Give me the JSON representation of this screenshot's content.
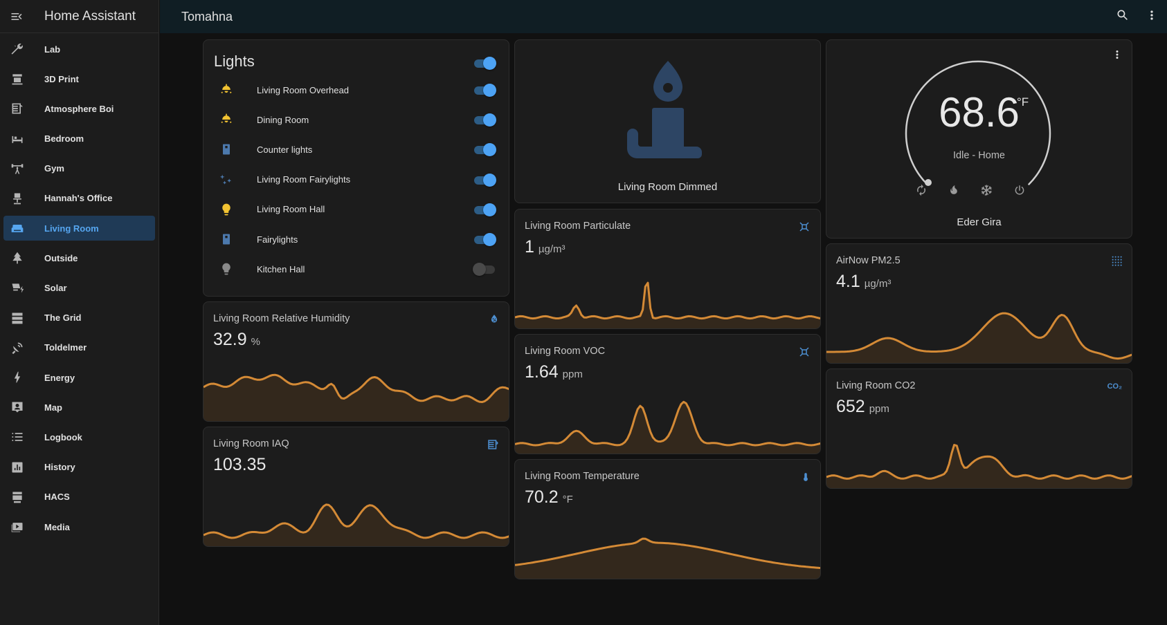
{
  "app": {
    "title": "Home Assistant"
  },
  "view": {
    "title": "Tomahna"
  },
  "sidebar": {
    "items": [
      {
        "label": "Lab",
        "icon": "tools-icon"
      },
      {
        "label": "3D Print",
        "icon": "printer-3d-icon"
      },
      {
        "label": "Atmosphere Boi",
        "icon": "air-filter-icon"
      },
      {
        "label": "Bedroom",
        "icon": "bed-icon"
      },
      {
        "label": "Gym",
        "icon": "weight-lifter-icon"
      },
      {
        "label": "Hannah's Office",
        "icon": "desk-chair-icon"
      },
      {
        "label": "Living Room",
        "icon": "sofa-icon",
        "selected": true
      },
      {
        "label": "Outside",
        "icon": "pine-tree-icon"
      },
      {
        "label": "Solar",
        "icon": "solar-power-icon"
      },
      {
        "label": "The Grid",
        "icon": "server-icon"
      },
      {
        "label": "Toldelmer",
        "icon": "satellite-dish-icon"
      },
      {
        "label": "Energy",
        "icon": "lightning-bolt-icon"
      },
      {
        "label": "Map",
        "icon": "map-account-icon"
      },
      {
        "label": "Logbook",
        "icon": "format-list-icon"
      },
      {
        "label": "History",
        "icon": "chart-box-icon"
      },
      {
        "label": "HACS",
        "icon": "hacs-icon"
      },
      {
        "label": "Media",
        "icon": "play-box-multiple-icon"
      }
    ]
  },
  "lights": {
    "title": "Lights",
    "master_on": true,
    "items": [
      {
        "name": "Living Room Overhead",
        "icon": "ceiling-light-icon",
        "on": true
      },
      {
        "name": "Dining Room",
        "icon": "ceiling-light-icon",
        "on": true
      },
      {
        "name": "Counter lights",
        "icon": "light-switch-icon",
        "on": true
      },
      {
        "name": "Living Room Fairylights",
        "icon": "string-lights-icon",
        "on": true
      },
      {
        "name": "Living Room Hall",
        "icon": "lightbulb-icon",
        "on": true
      },
      {
        "name": "Fairylights",
        "icon": "light-switch-icon",
        "on": true
      },
      {
        "name": "Kitchen Hall",
        "icon": "lightbulb-icon",
        "on": false
      }
    ]
  },
  "dimmed": {
    "name": "Living Room Dimmed",
    "icon": "candle-icon"
  },
  "thermostat": {
    "temperature": "68.6",
    "unit": "°F",
    "status": "Idle - Home",
    "name": "Eder Gira",
    "modes": [
      "autorenew-icon",
      "fire-icon",
      "snowflake-icon",
      "power-icon"
    ],
    "icon": "more-vertical-icon"
  },
  "sensors": {
    "humidity": {
      "name": "Living Room Relative Humidity",
      "value": "32.9",
      "unit": "%",
      "icon": "water-percent-icon"
    },
    "iaq": {
      "name": "Living Room IAQ",
      "value": "103.35",
      "unit": "",
      "icon": "air-filter-icon"
    },
    "particulate": {
      "name": "Living Room Particulate",
      "value": "1",
      "unit": "µg/m³",
      "icon": "molecule-icon"
    },
    "voc": {
      "name": "Living Room VOC",
      "value": "1.64",
      "unit": "ppm",
      "icon": "molecule-icon"
    },
    "temperature": {
      "name": "Living Room Temperature",
      "value": "70.2",
      "unit": "°F",
      "icon": "thermometer-icon"
    },
    "pm25": {
      "name": "AirNow PM2.5",
      "value": "4.1",
      "unit": "µg/m³",
      "icon": "blur-icon"
    },
    "co2": {
      "name": "Living Room CO2",
      "value": "652",
      "unit": "ppm",
      "icon": "molecule-co2-icon"
    }
  },
  "colors": {
    "accent": "#56a6f0",
    "graph": "#d48a36",
    "toggle_on": "#4da3f5"
  }
}
